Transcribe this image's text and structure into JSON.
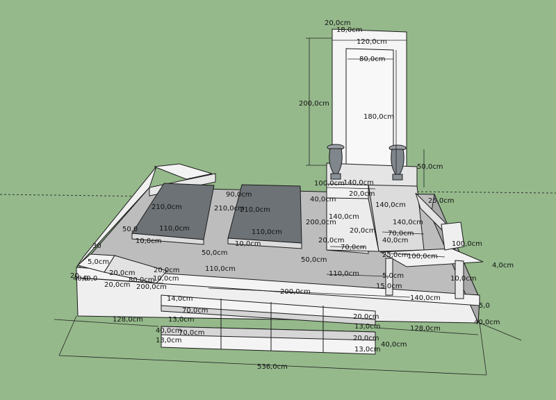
{
  "colors": {
    "background": "#95b98b",
    "stone_light": "#efefef",
    "stone_mid": "#bdbdbd",
    "stone_dark": "#8f8f8f",
    "slab": "#6d7276",
    "line": "#1a1a1a",
    "dimension": "#222222"
  },
  "dimensions": [
    {
      "id": "d-head-depth",
      "text": "20,0cm"
    },
    {
      "id": "d-head-inner-depth",
      "text": "18,0cm"
    },
    {
      "id": "d-head-width",
      "text": "120,0cm"
    },
    {
      "id": "d-head-inner-width",
      "text": "80,0cm"
    },
    {
      "id": "d-head-height",
      "text": "200,0cm"
    },
    {
      "id": "d-head-inner-height",
      "text": "180,0cm"
    },
    {
      "id": "d-vase-height",
      "text": "50,0cm"
    },
    {
      "id": "d-base-100",
      "text": "100,0cm"
    },
    {
      "id": "d-base-140a",
      "text": "140,0cm"
    },
    {
      "id": "d-base-20a",
      "text": "20,0cm"
    },
    {
      "id": "d-base-40a",
      "text": "40,0cm"
    },
    {
      "id": "d-base-140b",
      "text": "140,0cm"
    },
    {
      "id": "d-base-140c",
      "text": "140,0cm"
    },
    {
      "id": "d-base-200",
      "text": "200,0cm"
    },
    {
      "id": "d-base-20b",
      "text": "20,0cm"
    },
    {
      "id": "d-base-70a",
      "text": "70,0cm"
    },
    {
      "id": "d-base-40b",
      "text": "40,0cm"
    },
    {
      "id": "d-base-20c",
      "text": "20,0cm"
    },
    {
      "id": "d-base-70b",
      "text": "70,0cm"
    },
    {
      "id": "d-base-140d",
      "text": "140,0cm"
    },
    {
      "id": "d-slab1-210",
      "text": "210,0cm"
    },
    {
      "id": "d-slab1-110",
      "text": "110,0cm"
    },
    {
      "id": "d-slab1-10",
      "text": "10,0cm"
    },
    {
      "id": "d-slab2-210a",
      "text": "210,0cm"
    },
    {
      "id": "d-slab2-210b",
      "text": "210,0cm"
    },
    {
      "id": "d-slab2-110",
      "text": "110,0cm"
    },
    {
      "id": "d-slab2-10",
      "text": "10,0cm"
    },
    {
      "id": "d-gap-90",
      "text": "90,0cm"
    },
    {
      "id": "d-left-50",
      "text": "50,0"
    },
    {
      "id": "d-mid-50a",
      "text": "50,0cm"
    },
    {
      "id": "d-mid-50b",
      "text": "50,0cm"
    },
    {
      "id": "d-mid-110a",
      "text": "110,0cm"
    },
    {
      "id": "d-mid-110b",
      "text": "110,0cm"
    },
    {
      "id": "d-left-5",
      "text": "5,0cm"
    },
    {
      "id": "d-left-20a",
      "text": "20,0cm"
    },
    {
      "id": "d-left-40",
      "text": "40,0"
    },
    {
      "id": "d-left-80",
      "text": "80,0cm"
    },
    {
      "id": "d-left-10",
      "text": "10,0cm"
    },
    {
      "id": "d-left-20b",
      "text": "20,0cm"
    },
    {
      "id": "d-left-20c",
      "text": "20,0cm"
    },
    {
      "id": "d-left-200",
      "text": "200,0cm"
    },
    {
      "id": "d-front-200",
      "text": "200,0cm"
    },
    {
      "id": "d-front-140",
      "text": "140,0cm"
    },
    {
      "id": "d-front-15",
      "text": "15,0cm"
    },
    {
      "id": "d-front-5",
      "text": "5,0cm"
    },
    {
      "id": "d-right-25a",
      "text": "25,0cm"
    },
    {
      "id": "d-right-100a",
      "text": "100,0cm"
    },
    {
      "id": "d-right-25b",
      "text": "25,0cm"
    },
    {
      "id": "d-right-100b",
      "text": "100,0cm"
    },
    {
      "id": "d-right-4",
      "text": "4,0cm"
    },
    {
      "id": "d-right-10",
      "text": "10,0cm"
    },
    {
      "id": "d-right-5",
      "text": "5,0"
    },
    {
      "id": "d-right-40",
      "text": "40,0cm"
    },
    {
      "id": "d-step-14",
      "text": "14,0cm"
    },
    {
      "id": "d-step-70a",
      "text": "70,0cm"
    },
    {
      "id": "d-step-13a",
      "text": "13,0cm"
    },
    {
      "id": "d-step-40",
      "text": "40,0cm"
    },
    {
      "id": "d-step-70b",
      "text": "70,0cm"
    },
    {
      "id": "d-step-13b",
      "text": "13,0cm"
    },
    {
      "id": "d-step-20a",
      "text": "20,0cm"
    },
    {
      "id": "d-step-13c",
      "text": "13,0cm"
    },
    {
      "id": "d-step-20b",
      "text": "20,0cm"
    },
    {
      "id": "d-step-40b",
      "text": "40,0cm"
    },
    {
      "id": "d-step-13d",
      "text": "13,0cm"
    },
    {
      "id": "d-bottom-128a",
      "text": "128,0cm"
    },
    {
      "id": "d-bottom-128b",
      "text": "128,0cm"
    },
    {
      "id": "d-total-536",
      "text": "536,0cm"
    },
    {
      "id": "d-left-30",
      "text": "30"
    },
    {
      "id": "d-left-20d",
      "text": "20"
    },
    {
      "id": "d-left-40b",
      "text": "40,0"
    }
  ]
}
